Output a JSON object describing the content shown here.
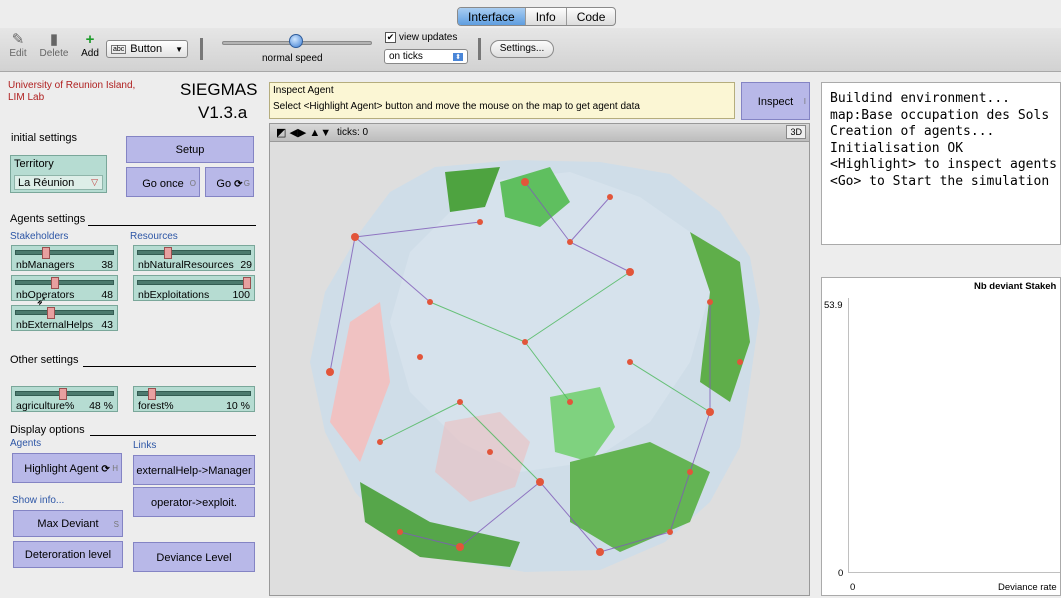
{
  "tabs": [
    "Interface",
    "Info",
    "Code"
  ],
  "toolbar": {
    "edit": "Edit",
    "delete": "Delete",
    "add": "Add",
    "widget_type": "Button",
    "speed_label": "normal speed",
    "view_updates": "view updates",
    "update_mode": "on ticks",
    "settings": "Settings..."
  },
  "header": {
    "org": "University of Reunion Island, LIM Lab",
    "title": "SIEGMAS",
    "version": "V1.3.a"
  },
  "initial_settings": {
    "label": "initial settings",
    "setup": "Setup",
    "go_once": "Go once",
    "go_once_key": "O",
    "go": "Go",
    "go_key": "G",
    "territory_label": "Territory",
    "territory_value": "La Réunion"
  },
  "agents_settings": {
    "label": "Agents settings",
    "stakeholders": "Stakeholders",
    "resources": "Resources",
    "sliders": [
      {
        "name": "nbManagers",
        "value": "38",
        "level": 0.3
      },
      {
        "name": "nbOperators",
        "value": "48",
        "level": 0.4
      },
      {
        "name": "nbExternalHelps",
        "value": "43",
        "level": 0.35
      },
      {
        "name": "nbNaturalResources",
        "value": "29",
        "level": 0.25
      },
      {
        "name": "nbExploitations",
        "value": "100",
        "level": 1.0
      }
    ]
  },
  "other_settings": {
    "label": "Other settings",
    "sliders": [
      {
        "name": "agriculture%",
        "value": "48 %",
        "level": 0.48
      },
      {
        "name": "forest%",
        "value": "10 %",
        "level": 0.1
      }
    ]
  },
  "display_options": {
    "label": "Display options",
    "agents": "Agents",
    "links": "Links",
    "highlight_agent": "Highlight Agent",
    "highlight_key": "H",
    "external_help": "externalHelp->Manager",
    "operator_exploit": "operator->exploit.",
    "show_info": "Show info...",
    "max_deviant": "Max Deviant",
    "max_key": "S",
    "deteroration": "Deteroration level",
    "deviance_level": "Deviance Level"
  },
  "inspect": {
    "title": "Inspect Agent",
    "text": "Select <Highlight Agent> button and move the mouse on the map to get agent data",
    "button": "Inspect",
    "key": "I"
  },
  "world": {
    "ticks": "ticks: 0",
    "btn3d": "3D"
  },
  "output_lines": [
    "Buildind environment...",
    "map:Base occupation des Sols",
    "Creation of agents...",
    "Initialisation OK",
    "<Highlight> to inspect agents",
    "<Go> to Start the simulation"
  ],
  "plot": {
    "title": "Nb deviant Stakeh",
    "ymax": "53.9",
    "ymin": "0",
    "xmin": "0",
    "xlabel": "Deviance rate"
  }
}
